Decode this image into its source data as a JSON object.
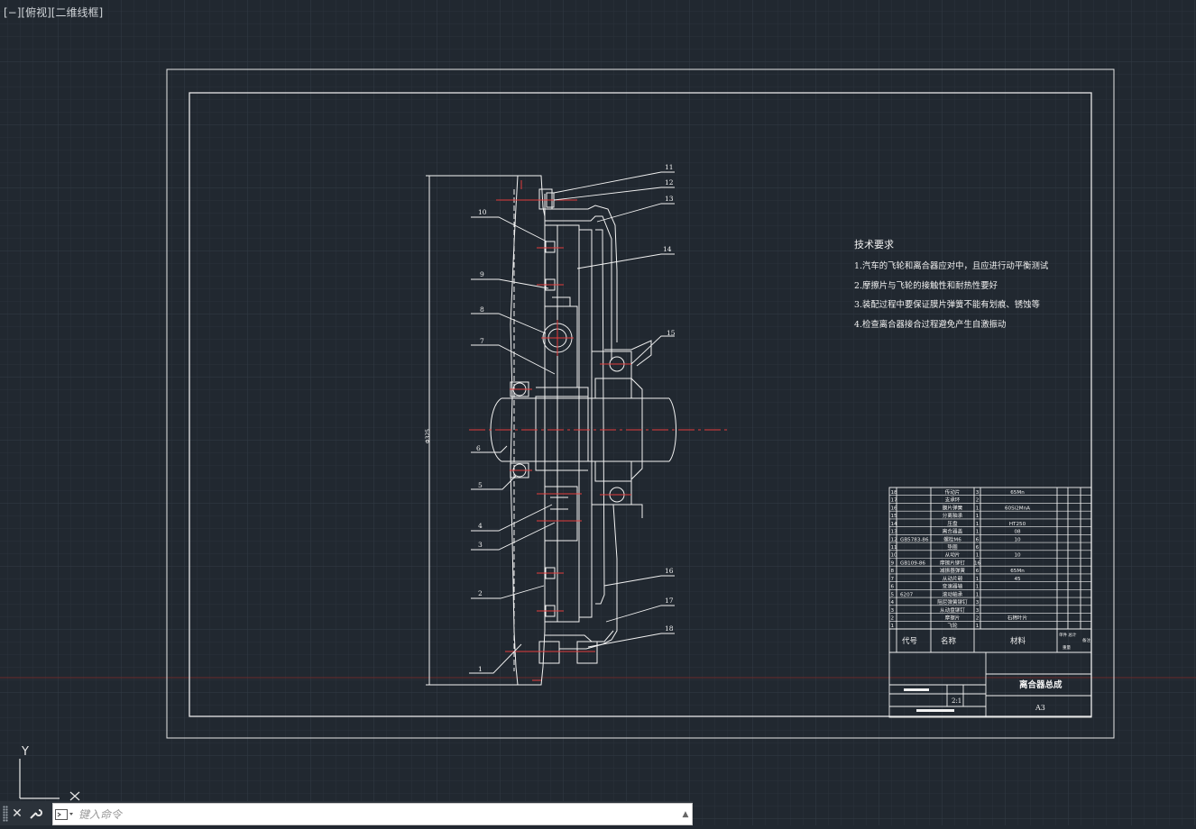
{
  "viewport": {
    "label": "[−][俯视][二维线框]"
  },
  "ucs": {
    "y_label": "Y",
    "x_label": "X"
  },
  "drawing": {
    "balloons": [
      "1",
      "2",
      "3",
      "4",
      "5",
      "6",
      "7",
      "8",
      "9",
      "10",
      "11",
      "12",
      "13",
      "14",
      "15",
      "16",
      "17",
      "18"
    ],
    "dimension_text": "Φ325",
    "tech_title": "技术要求",
    "tech_notes": [
      "1.汽车的飞轮和离合器应对中，且应进行动平衡测试",
      "2.摩擦片与飞轮的接触性和耐热性要好",
      "3.装配过程中要保证膜片弹簧不能有划痕、锈蚀等",
      "4.检查离合器接合过程避免产生自激振动"
    ]
  },
  "title_block": {
    "header_code": "代号",
    "header_name": "名称",
    "header_material": "材料",
    "header_extra1": "单件 总计",
    "header_extra2": "重量",
    "header_extra3": "备注",
    "rows": [
      {
        "no": "18",
        "code": "",
        "name": "传动片",
        "qty": "3",
        "material": "65Mn"
      },
      {
        "no": "17",
        "code": "",
        "name": "支承环",
        "qty": "2",
        "material": ""
      },
      {
        "no": "16",
        "code": "",
        "name": "膜片弹簧",
        "qty": "1",
        "material": "60Si2MnA"
      },
      {
        "no": "15",
        "code": "",
        "name": "分离轴承",
        "qty": "1",
        "material": ""
      },
      {
        "no": "14",
        "code": "",
        "name": "压盘",
        "qty": "1",
        "material": "HT250"
      },
      {
        "no": "13",
        "code": "",
        "name": "离合器盖",
        "qty": "1",
        "material": "08"
      },
      {
        "no": "12",
        "code": "GB5783-86",
        "name": "螺栓M6",
        "qty": "6",
        "material": "10"
      },
      {
        "no": "11",
        "code": "",
        "name": "垫圈",
        "qty": "6",
        "material": ""
      },
      {
        "no": "10",
        "code": "",
        "name": "从动片",
        "qty": "1",
        "material": "10"
      },
      {
        "no": "9",
        "code": "GB109-86",
        "name": "摩擦片铆钉",
        "qty": "16",
        "material": ""
      },
      {
        "no": "8",
        "code": "",
        "name": "减振器弹簧",
        "qty": "6",
        "material": "65Mn"
      },
      {
        "no": "7",
        "code": "",
        "name": "从动片毂",
        "qty": "1",
        "material": "45"
      },
      {
        "no": "6",
        "code": "",
        "name": "变速器轴",
        "qty": "1",
        "material": ""
      },
      {
        "no": "5",
        "code": "6207",
        "name": "滚动轴承",
        "qty": "1",
        "material": ""
      },
      {
        "no": "4",
        "code": "",
        "name": "阻尼弹簧铆钉",
        "qty": "3",
        "material": ""
      },
      {
        "no": "3",
        "code": "",
        "name": "从动盘铆钉",
        "qty": "3",
        "material": ""
      },
      {
        "no": "2",
        "code": "",
        "name": "摩擦片",
        "qty": "2",
        "material": "石棉叶片"
      },
      {
        "no": "1",
        "code": "",
        "name": "飞轮",
        "qty": "1",
        "material": ""
      }
    ],
    "drawing_title": "离合器总成",
    "scale": "2:1",
    "sheet": "A3"
  },
  "command_line": {
    "placeholder": "键入命令"
  }
}
